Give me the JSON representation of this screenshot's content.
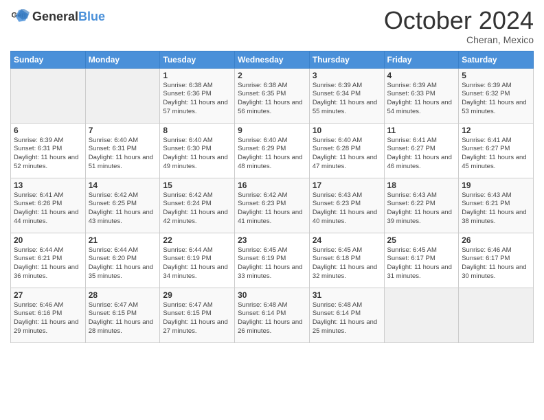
{
  "header": {
    "logo": {
      "general": "General",
      "blue": "Blue"
    },
    "title": "October 2024",
    "location": "Cheran, Mexico"
  },
  "days_of_week": [
    "Sunday",
    "Monday",
    "Tuesday",
    "Wednesday",
    "Thursday",
    "Friday",
    "Saturday"
  ],
  "weeks": [
    [
      {
        "day": "",
        "sunrise": "",
        "sunset": "",
        "daylight": ""
      },
      {
        "day": "",
        "sunrise": "",
        "sunset": "",
        "daylight": ""
      },
      {
        "day": "1",
        "sunrise": "Sunrise: 6:38 AM",
        "sunset": "Sunset: 6:36 PM",
        "daylight": "Daylight: 11 hours and 57 minutes."
      },
      {
        "day": "2",
        "sunrise": "Sunrise: 6:38 AM",
        "sunset": "Sunset: 6:35 PM",
        "daylight": "Daylight: 11 hours and 56 minutes."
      },
      {
        "day": "3",
        "sunrise": "Sunrise: 6:39 AM",
        "sunset": "Sunset: 6:34 PM",
        "daylight": "Daylight: 11 hours and 55 minutes."
      },
      {
        "day": "4",
        "sunrise": "Sunrise: 6:39 AM",
        "sunset": "Sunset: 6:33 PM",
        "daylight": "Daylight: 11 hours and 54 minutes."
      },
      {
        "day": "5",
        "sunrise": "Sunrise: 6:39 AM",
        "sunset": "Sunset: 6:32 PM",
        "daylight": "Daylight: 11 hours and 53 minutes."
      }
    ],
    [
      {
        "day": "6",
        "sunrise": "Sunrise: 6:39 AM",
        "sunset": "Sunset: 6:31 PM",
        "daylight": "Daylight: 11 hours and 52 minutes."
      },
      {
        "day": "7",
        "sunrise": "Sunrise: 6:40 AM",
        "sunset": "Sunset: 6:31 PM",
        "daylight": "Daylight: 11 hours and 51 minutes."
      },
      {
        "day": "8",
        "sunrise": "Sunrise: 6:40 AM",
        "sunset": "Sunset: 6:30 PM",
        "daylight": "Daylight: 11 hours and 49 minutes."
      },
      {
        "day": "9",
        "sunrise": "Sunrise: 6:40 AM",
        "sunset": "Sunset: 6:29 PM",
        "daylight": "Daylight: 11 hours and 48 minutes."
      },
      {
        "day": "10",
        "sunrise": "Sunrise: 6:40 AM",
        "sunset": "Sunset: 6:28 PM",
        "daylight": "Daylight: 11 hours and 47 minutes."
      },
      {
        "day": "11",
        "sunrise": "Sunrise: 6:41 AM",
        "sunset": "Sunset: 6:27 PM",
        "daylight": "Daylight: 11 hours and 46 minutes."
      },
      {
        "day": "12",
        "sunrise": "Sunrise: 6:41 AM",
        "sunset": "Sunset: 6:27 PM",
        "daylight": "Daylight: 11 hours and 45 minutes."
      }
    ],
    [
      {
        "day": "13",
        "sunrise": "Sunrise: 6:41 AM",
        "sunset": "Sunset: 6:26 PM",
        "daylight": "Daylight: 11 hours and 44 minutes."
      },
      {
        "day": "14",
        "sunrise": "Sunrise: 6:42 AM",
        "sunset": "Sunset: 6:25 PM",
        "daylight": "Daylight: 11 hours and 43 minutes."
      },
      {
        "day": "15",
        "sunrise": "Sunrise: 6:42 AM",
        "sunset": "Sunset: 6:24 PM",
        "daylight": "Daylight: 11 hours and 42 minutes."
      },
      {
        "day": "16",
        "sunrise": "Sunrise: 6:42 AM",
        "sunset": "Sunset: 6:23 PM",
        "daylight": "Daylight: 11 hours and 41 minutes."
      },
      {
        "day": "17",
        "sunrise": "Sunrise: 6:43 AM",
        "sunset": "Sunset: 6:23 PM",
        "daylight": "Daylight: 11 hours and 40 minutes."
      },
      {
        "day": "18",
        "sunrise": "Sunrise: 6:43 AM",
        "sunset": "Sunset: 6:22 PM",
        "daylight": "Daylight: 11 hours and 39 minutes."
      },
      {
        "day": "19",
        "sunrise": "Sunrise: 6:43 AM",
        "sunset": "Sunset: 6:21 PM",
        "daylight": "Daylight: 11 hours and 38 minutes."
      }
    ],
    [
      {
        "day": "20",
        "sunrise": "Sunrise: 6:44 AM",
        "sunset": "Sunset: 6:21 PM",
        "daylight": "Daylight: 11 hours and 36 minutes."
      },
      {
        "day": "21",
        "sunrise": "Sunrise: 6:44 AM",
        "sunset": "Sunset: 6:20 PM",
        "daylight": "Daylight: 11 hours and 35 minutes."
      },
      {
        "day": "22",
        "sunrise": "Sunrise: 6:44 AM",
        "sunset": "Sunset: 6:19 PM",
        "daylight": "Daylight: 11 hours and 34 minutes."
      },
      {
        "day": "23",
        "sunrise": "Sunrise: 6:45 AM",
        "sunset": "Sunset: 6:19 PM",
        "daylight": "Daylight: 11 hours and 33 minutes."
      },
      {
        "day": "24",
        "sunrise": "Sunrise: 6:45 AM",
        "sunset": "Sunset: 6:18 PM",
        "daylight": "Daylight: 11 hours and 32 minutes."
      },
      {
        "day": "25",
        "sunrise": "Sunrise: 6:45 AM",
        "sunset": "Sunset: 6:17 PM",
        "daylight": "Daylight: 11 hours and 31 minutes."
      },
      {
        "day": "26",
        "sunrise": "Sunrise: 6:46 AM",
        "sunset": "Sunset: 6:17 PM",
        "daylight": "Daylight: 11 hours and 30 minutes."
      }
    ],
    [
      {
        "day": "27",
        "sunrise": "Sunrise: 6:46 AM",
        "sunset": "Sunset: 6:16 PM",
        "daylight": "Daylight: 11 hours and 29 minutes."
      },
      {
        "day": "28",
        "sunrise": "Sunrise: 6:47 AM",
        "sunset": "Sunset: 6:15 PM",
        "daylight": "Daylight: 11 hours and 28 minutes."
      },
      {
        "day": "29",
        "sunrise": "Sunrise: 6:47 AM",
        "sunset": "Sunset: 6:15 PM",
        "daylight": "Daylight: 11 hours and 27 minutes."
      },
      {
        "day": "30",
        "sunrise": "Sunrise: 6:48 AM",
        "sunset": "Sunset: 6:14 PM",
        "daylight": "Daylight: 11 hours and 26 minutes."
      },
      {
        "day": "31",
        "sunrise": "Sunrise: 6:48 AM",
        "sunset": "Sunset: 6:14 PM",
        "daylight": "Daylight: 11 hours and 25 minutes."
      },
      {
        "day": "",
        "sunrise": "",
        "sunset": "",
        "daylight": ""
      },
      {
        "day": "",
        "sunrise": "",
        "sunset": "",
        "daylight": ""
      }
    ]
  ]
}
